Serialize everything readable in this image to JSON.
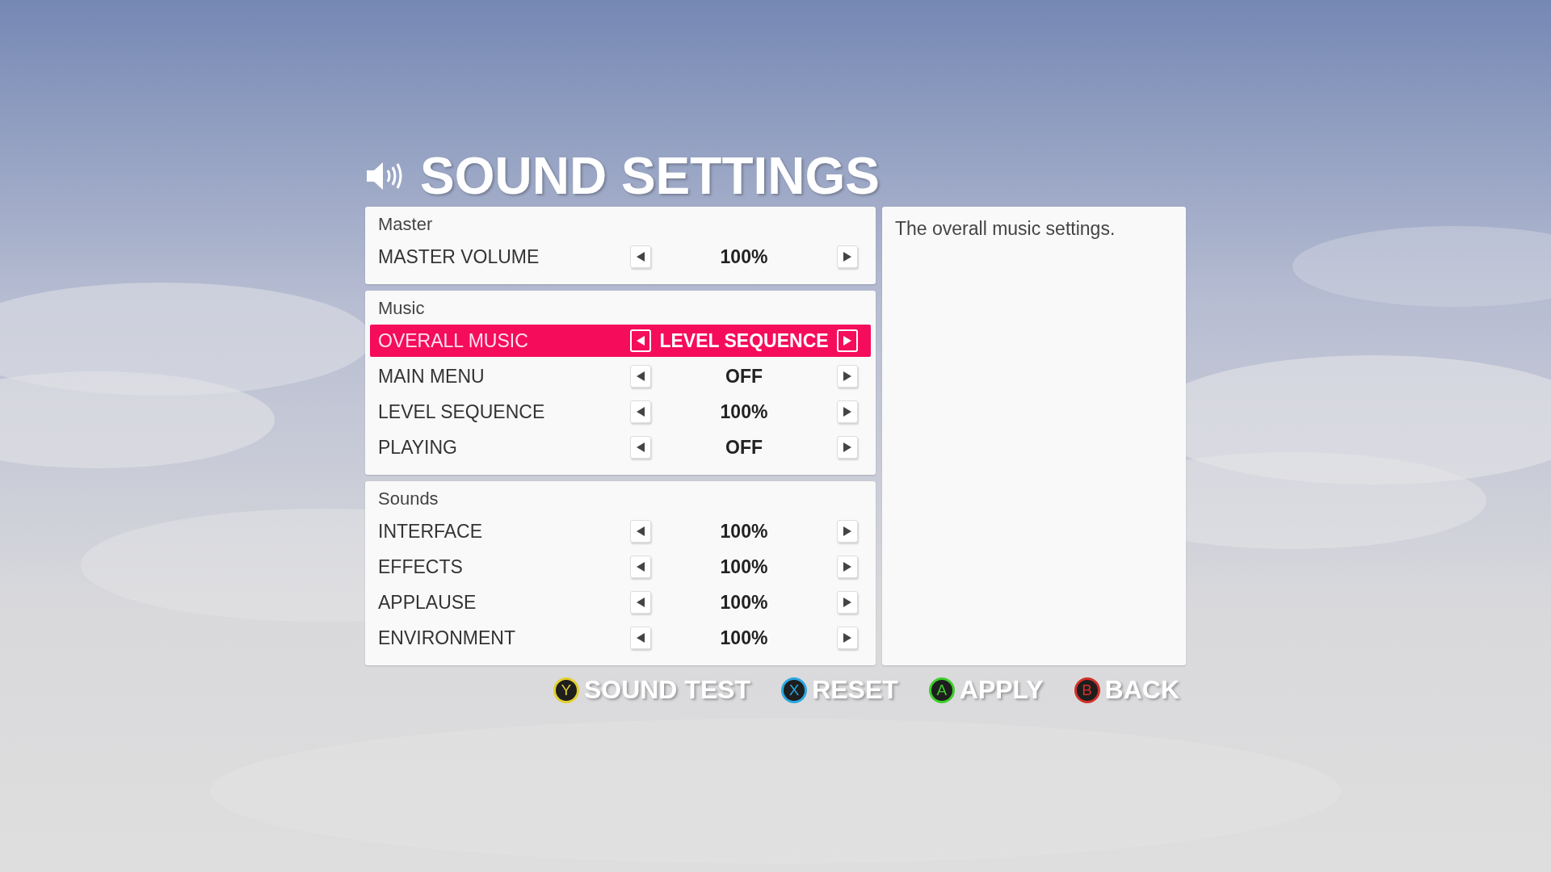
{
  "title": "SOUND SETTINGS",
  "groups": [
    {
      "heading": "Master",
      "rows": [
        {
          "label": "MASTER VOLUME",
          "value": "100%",
          "selected": false
        }
      ]
    },
    {
      "heading": "Music",
      "rows": [
        {
          "label": "OVERALL MUSIC",
          "value": "LEVEL SEQUENCE",
          "selected": true
        },
        {
          "label": "MAIN MENU",
          "value": "OFF",
          "selected": false
        },
        {
          "label": "LEVEL SEQUENCE",
          "value": "100%",
          "selected": false
        },
        {
          "label": "PLAYING",
          "value": "OFF",
          "selected": false
        }
      ]
    },
    {
      "heading": "Sounds",
      "rows": [
        {
          "label": "INTERFACE",
          "value": "100%",
          "selected": false
        },
        {
          "label": "EFFECTS",
          "value": "100%",
          "selected": false
        },
        {
          "label": "APPLAUSE",
          "value": "100%",
          "selected": false
        },
        {
          "label": "ENVIRONMENT",
          "value": "100%",
          "selected": false
        }
      ]
    }
  ],
  "description": "The overall music settings.",
  "footer": [
    {
      "key": "Y",
      "label": "SOUND TEST",
      "color": "#e2cf2c"
    },
    {
      "key": "X",
      "label": "RESET",
      "color": "#2aa6df"
    },
    {
      "key": "A",
      "label": "APPLY",
      "color": "#3fce2c"
    },
    {
      "key": "B",
      "label": "BACK",
      "color": "#d2302a"
    }
  ]
}
